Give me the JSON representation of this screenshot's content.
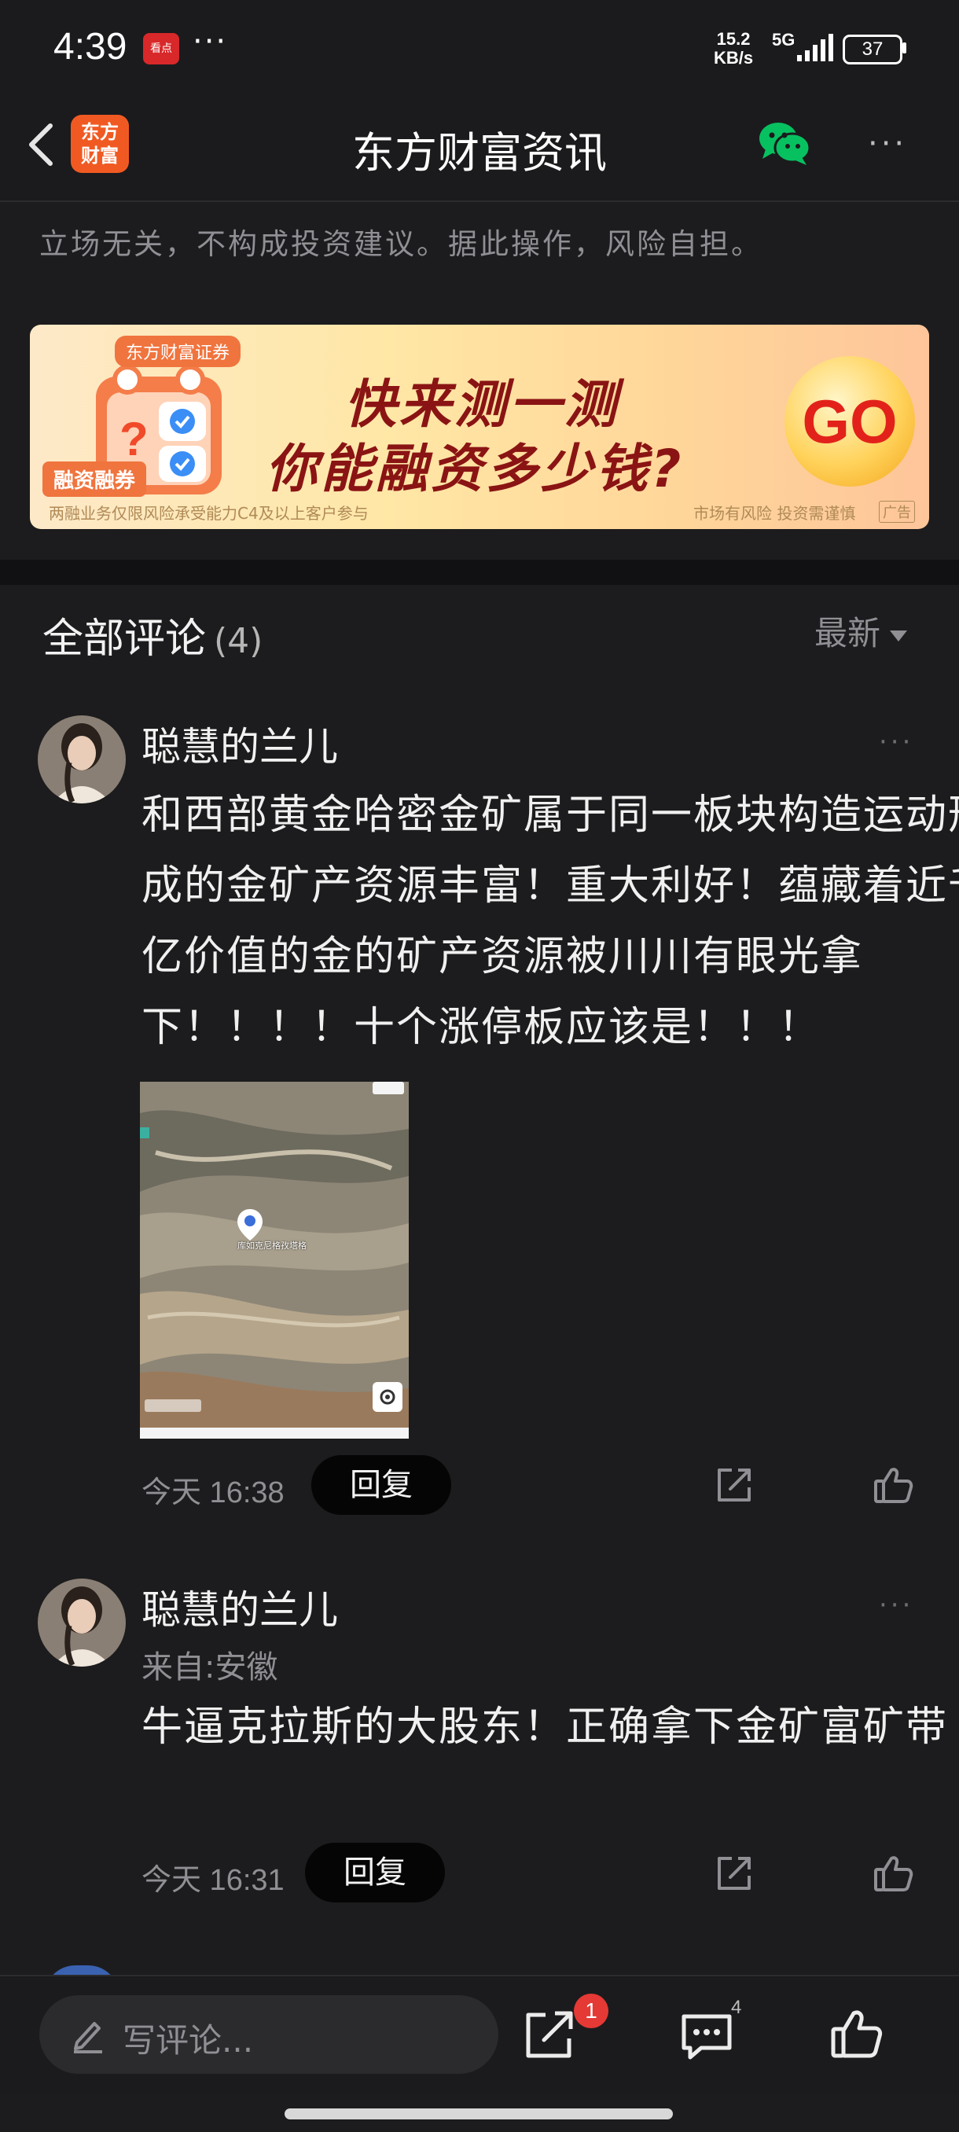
{
  "status_bar": {
    "time": "4:39",
    "app_icon_label": "看点",
    "notification_dots": "···",
    "net_speed_value": "15.2",
    "net_speed_unit": "KB/s",
    "network": "5G",
    "battery": "37"
  },
  "nav": {
    "logo_line1": "东方",
    "logo_line2": "财富",
    "title": "东方财富资讯",
    "more": "···"
  },
  "disclaimer": "立场无关，不构成投资建议。据此操作，风险自担。",
  "banner": {
    "brand": "东方财富证券",
    "tag": "融资融券",
    "headline_line1": "快来测一测",
    "headline_line2": "你能融资多少钱?",
    "button": "GO",
    "footnote_left": "两融业务仅限风险承受能力C4及以上客户参与",
    "footnote_right": "市场有风险 投资需谨慎",
    "ad_label": "广告"
  },
  "comments_section": {
    "title": "全部评论",
    "count": "(4)",
    "sort_selected": "最新"
  },
  "comments": [
    {
      "username": "聪慧的兰儿",
      "more": "···",
      "text": "和西部黄金哈密金矿属于同一板块构造运动形成的金矿产资源丰富！重大利好！蕴藏着近千亿价值的金的矿产资源被川川有眼光拿下！！！！十个涨停板应该是！！！",
      "time": "今天 16:38",
      "reply_label": "回复",
      "map_label": "库如克尼格孜塔格"
    },
    {
      "username": "聪慧的兰儿",
      "more": "···",
      "location": "来自:安徽",
      "text": "牛逼克拉斯的大股东！正确拿下金矿富矿带",
      "time": "今天 16:31",
      "reply_label": "回复"
    }
  ],
  "bottom_bar": {
    "comment_placeholder": "写评论...",
    "share_badge": "1",
    "comment_count": "4"
  },
  "colors": {
    "background": "#1c1c1e",
    "brand_orange": "#f05a22",
    "wechat_green": "#07c160",
    "badge_red": "#e53935"
  },
  "icons": [
    "back-icon",
    "wechat-icon",
    "more-icon",
    "share-icon",
    "like-icon",
    "pencil-icon",
    "comment-icon",
    "map-pin-icon",
    "locate-icon"
  ]
}
